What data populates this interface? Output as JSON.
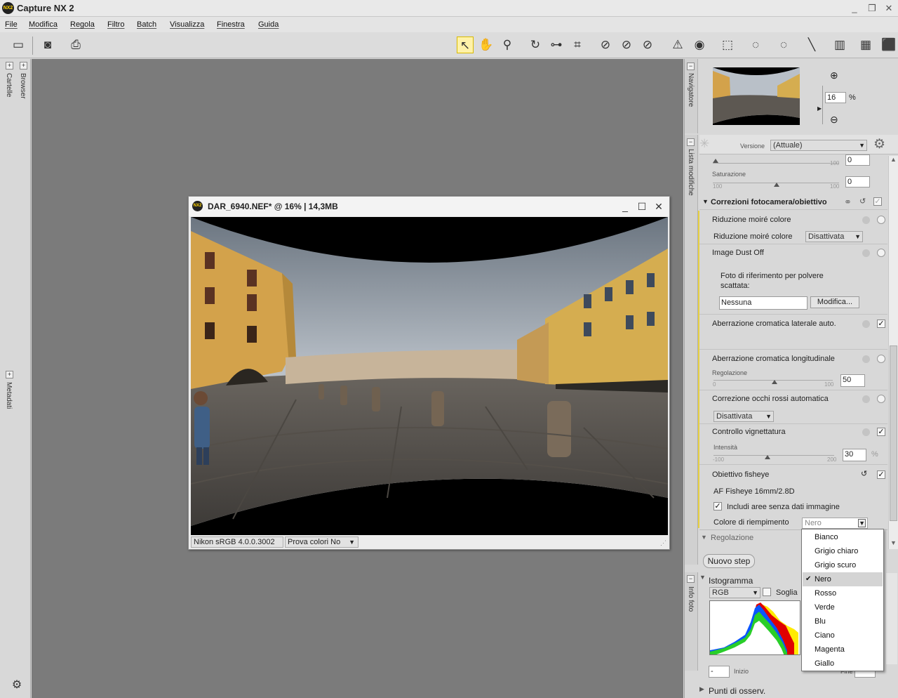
{
  "app": {
    "title": "Capture NX 2",
    "logo_text": "NX2"
  },
  "window_controls": {
    "minimize": "_",
    "restore": "❐",
    "close": "✕"
  },
  "menu": [
    "File",
    "Modifica",
    "Regola",
    "Filtro",
    "Batch",
    "Visualizza",
    "Finestra",
    "Guida"
  ],
  "left_panel": {
    "tabs": [
      "Cartelle",
      "Browser",
      "Metadati"
    ]
  },
  "image_window": {
    "title": "DAR_6940.NEF* @ 16% | 14,3MB",
    "color_profile": "Nikon sRGB 4.0.0.3002",
    "soft_proof": "Prova colori No",
    "controls": {
      "minimize": "_",
      "maximize": "☐",
      "close": "✕"
    }
  },
  "navigator": {
    "tab": "Navigatore",
    "zoom_value": "16",
    "zoom_unit": "%"
  },
  "edit_list": {
    "tab": "Lista modifiche",
    "version_label": "Versione",
    "version_value": "(Attuale)",
    "top_slider": {
      "max": "100",
      "value": "0"
    },
    "saturation": {
      "label": "Saturazione",
      "min": "100",
      "max": "100",
      "value": "0"
    },
    "section_title": "Correzioni fotocamera/obiettivo",
    "moire": {
      "title": "Riduzione moiré colore",
      "label": "Riduzione moiré colore",
      "value": "Disattivata"
    },
    "dust": {
      "title": "Image Dust Off",
      "ref_text_1": "Foto di riferimento per polvere",
      "ref_text_2": "scattata:",
      "ref_value": "Nessuna",
      "button": "Modifica..."
    },
    "lateral_ca": {
      "title": "Aberrazione cromatica laterale auto."
    },
    "longitudinal_ca": {
      "title": "Aberrazione cromatica longitudinale",
      "sub": "Regolazione",
      "min": "0",
      "max": "100",
      "value": "50"
    },
    "redeye": {
      "title": "Correzione occhi rossi automatica",
      "value": "Disattivata"
    },
    "vignette": {
      "title": "Controllo vignettatura",
      "sub": "Intensità",
      "min": "-100",
      "max": "200",
      "value": "30",
      "unit": "%"
    },
    "fisheye": {
      "title": "Obiettivo fisheye",
      "lens": "AF Fisheye 16mm/2.8D",
      "include_label": "Includi aree senza dati immagine",
      "include_checked": true,
      "fill_label": "Colore di riempimento",
      "fill_value": "Nero"
    },
    "adjust_section": "Regolazione",
    "new_step": "Nuovo step"
  },
  "dropdown": {
    "options": [
      "Bianco",
      "Grigio chiaro",
      "Grigio scuro",
      "Nero",
      "Rosso",
      "Verde",
      "Blu",
      "Ciano",
      "Magenta",
      "Giallo"
    ],
    "selected_index": 3
  },
  "histogram": {
    "tab": "Info foto",
    "title": "Istogramma",
    "channel": "RGB",
    "threshold_label": "Soglia",
    "start_label": "Inizio",
    "start_value": "-",
    "end_label": "Fine"
  },
  "watch_points": "Punti di osserv.",
  "colors": {
    "accent_yellow": "#fff2a8",
    "workspace": "#7b7b7b"
  }
}
